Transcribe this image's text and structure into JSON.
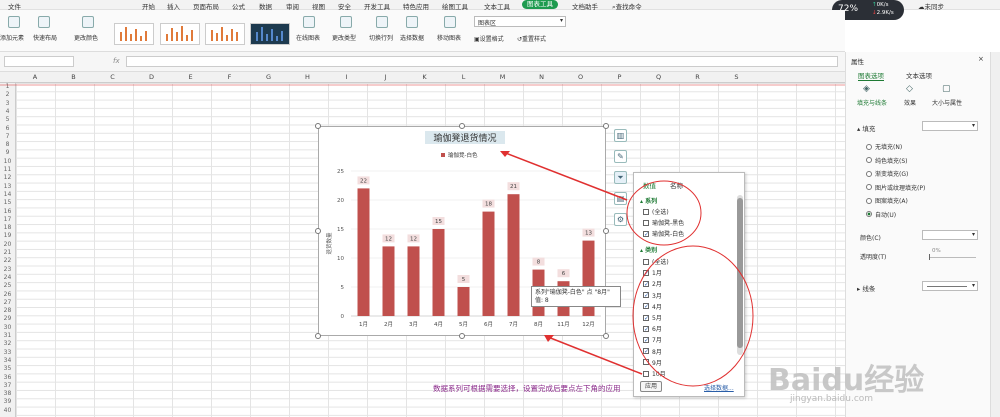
{
  "titlebar": {
    "menus": [
      "文件",
      "开始",
      "插入",
      "页面布局",
      "公式",
      "数据",
      "审阅",
      "视图",
      "安全",
      "开发工具",
      "特色应用",
      "绘图工具",
      "文本工具",
      "图表工具",
      "文档助手"
    ],
    "search": "查找命令",
    "sync": "未同步",
    "share": "分享",
    "cpu_pct": "72%",
    "net_up": "0K/s",
    "net_down": "2.9K/s"
  },
  "ribbon": {
    "add_element": "添加元素",
    "quick_layout": "快速布局",
    "change_color": "更改颜色",
    "online_chart": "在线图表",
    "change_type": "更改类型",
    "switch_rowcol": "切换行列",
    "select_data": "选择数据",
    "move_chart": "移动图表",
    "chart_area_select": "图表区",
    "set_format": "设置格式",
    "reset_style": "重置样式"
  },
  "formula": {
    "name_box": "",
    "fx": "fx"
  },
  "columns": [
    "A",
    "B",
    "C",
    "D",
    "E",
    "F",
    "G",
    "H",
    "I",
    "J",
    "K",
    "L",
    "M",
    "N",
    "O",
    "P",
    "Q",
    "R",
    "S"
  ],
  "rows": [
    "1",
    "2",
    "3",
    "4",
    "5",
    "6",
    "7",
    "8",
    "9",
    "10",
    "11",
    "12",
    "13",
    "14",
    "15",
    "16",
    "17",
    "18",
    "19",
    "20",
    "21",
    "22",
    "23",
    "24",
    "25",
    "26",
    "27",
    "28",
    "29",
    "30",
    "31",
    "32",
    "33",
    "34",
    "35",
    "36",
    "37",
    "38",
    "39",
    "40"
  ],
  "chart_data": {
    "type": "bar",
    "title": "瑜伽凳退货情况",
    "ylabel": "退货数量",
    "xlabel": "",
    "legend": "top",
    "legend_entry": "瑜伽凳-白色",
    "categories": [
      "1月",
      "2月",
      "3月",
      "4月",
      "5月",
      "6月",
      "7月",
      "8月",
      "9月",
      "10月",
      "11月",
      "12月"
    ],
    "series": [
      {
        "name": "瑜伽凳-白色",
        "values": [
          22,
          12,
          12,
          15,
          5,
          18,
          21,
          8,
          6,
          0,
          0,
          13
        ],
        "color": "#c0504d"
      }
    ],
    "visible_categories": [
      "1月",
      "2月",
      "3月",
      "4月",
      "5月",
      "6月",
      "7月",
      "8月",
      "11月",
      "12月"
    ],
    "visible_values": [
      22,
      12,
      12,
      15,
      5,
      18,
      21,
      8,
      6,
      13
    ],
    "yticks": [
      "0",
      "5",
      "10",
      "15",
      "20",
      "25"
    ],
    "ylim": [
      0,
      25
    ],
    "grid": true
  },
  "tooltip": {
    "line1": "系列\"瑜伽凳-白色\" 点 \"8月\"",
    "line2": "值: 8"
  },
  "filter_panel": {
    "tab_values": "数值",
    "tab_names": "名称",
    "section_series": "系列",
    "series_items": [
      {
        "label": "(全选)",
        "checked": false
      },
      {
        "label": "瑜伽凳-黑色",
        "checked": false
      },
      {
        "label": "瑜伽凳-白色",
        "checked": true
      }
    ],
    "section_category": "类别",
    "category_items": [
      {
        "label": "(全选)",
        "checked": false
      },
      {
        "label": "1月",
        "checked": true
      },
      {
        "label": "2月",
        "checked": true
      },
      {
        "label": "3月",
        "checked": true
      },
      {
        "label": "4月",
        "checked": true
      },
      {
        "label": "5月",
        "checked": true
      },
      {
        "label": "6月",
        "checked": true
      },
      {
        "label": "7月",
        "checked": true
      },
      {
        "label": "8月",
        "checked": true
      },
      {
        "label": "9月",
        "checked": false
      },
      {
        "label": "10月",
        "checked": false
      }
    ],
    "apply": "应用",
    "select_data_link": "选择数据..."
  },
  "panel": {
    "title": "属性",
    "tab_chart_options": "图表选项",
    "tab_text_options": "文本选项",
    "sub_fill_line": "填充与线条",
    "sub_effects": "效果",
    "sub_size": "大小与属性",
    "fill_header": "填充",
    "fill_options": [
      {
        "label": "无填充(N)",
        "on": false
      },
      {
        "label": "纯色填充(S)",
        "on": false
      },
      {
        "label": "渐变填充(G)",
        "on": false
      },
      {
        "label": "图片或纹理填充(P)",
        "on": false
      },
      {
        "label": "图案填充(A)",
        "on": false
      },
      {
        "label": "自动(U)",
        "on": true
      }
    ],
    "color_label": "颜色(C)",
    "transparency_label": "透明度(T)",
    "transparency_value": "0%",
    "line_header": "线条"
  },
  "annotation": "数据系列可根据需要选择，设置完成后要点左下角的应用",
  "watermark": "Baidu经验",
  "watermark_url": "jingyan.baidu.com"
}
